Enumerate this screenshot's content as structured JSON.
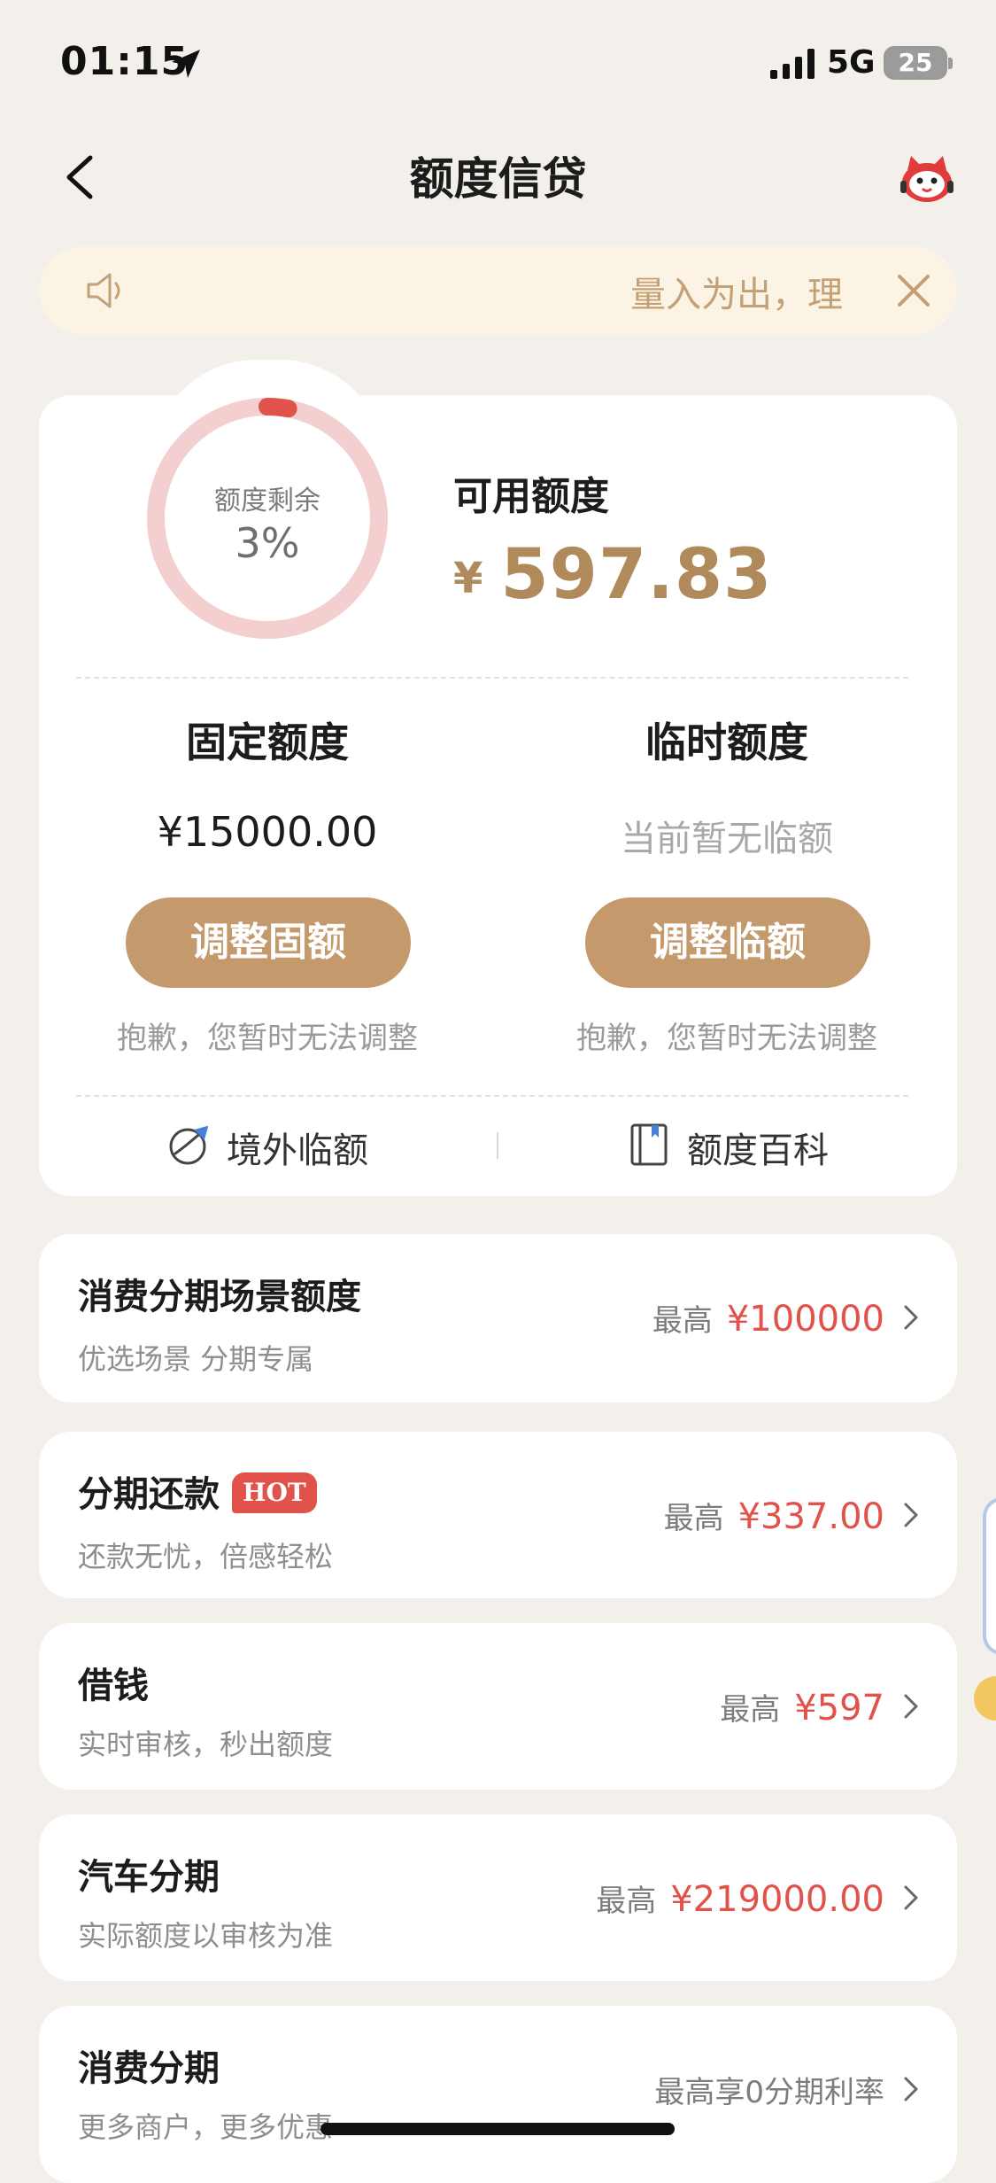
{
  "status_bar": {
    "time": "01:15",
    "network": "5G",
    "battery": "25"
  },
  "header": {
    "title": "额度信贷"
  },
  "notice": {
    "text": "量入为出，理"
  },
  "quota": {
    "ring_label": "额度剩余",
    "ring_percent": "3%",
    "remaining_fraction": 0.03,
    "available_title": "可用额度",
    "available_currency": "¥",
    "available_amount": "597.83",
    "fixed": {
      "title": "固定额度",
      "value": "¥15000.00",
      "button_label": "调整固额",
      "note": "抱歉，您暂时无法调整"
    },
    "temporary": {
      "title": "临时额度",
      "value": "当前暂无临额",
      "button_label": "调整临额",
      "note": "抱歉，您暂时无法调整"
    },
    "links": {
      "overseas": "境外临额",
      "encyclopedia": "额度百科"
    }
  },
  "products": [
    {
      "title": "消费分期场景额度",
      "subtitle": "优选场景 分期专属",
      "prefix": "最高",
      "value": "¥100000"
    },
    {
      "title": "分期还款",
      "badge": "HOT",
      "subtitle": "还款无忧，倍感轻松",
      "prefix": "最高",
      "value": "¥337.00"
    },
    {
      "title": "借钱",
      "subtitle": "实时审核，秒出额度",
      "prefix": "最高",
      "value": "¥597"
    },
    {
      "title": "汽车分期",
      "subtitle": "实际额度以审核为准",
      "prefix": "最高",
      "value": "¥219000.00"
    },
    {
      "title": "消费分期",
      "subtitle": "更多商户，更多优惠",
      "prefix": "最高享0分期利率",
      "value": ""
    }
  ],
  "colors": {
    "background": "#f3efea",
    "accent_gold": "#c49a6c",
    "amount_gold": "#b18a5b",
    "price_red": "#e0524a",
    "notice_bg": "#fbf3e3",
    "ring_track": "#f3cfcf",
    "ring_fill": "#e0524a"
  },
  "icons": {
    "back": "chevron-left-icon",
    "mascot": "mascot-icon",
    "notice": "speaker-icon",
    "close": "close-icon",
    "overseas": "globe-plane-icon",
    "encyclopedia": "book-icon",
    "chevron": "chevron-right-icon",
    "location": "location-arrow-icon",
    "signal": "signal-icon"
  }
}
